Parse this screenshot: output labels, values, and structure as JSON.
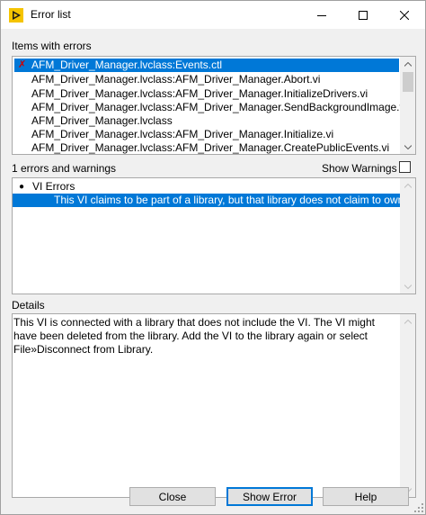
{
  "window": {
    "title": "Error list",
    "colors": {
      "accent": "#0078d7",
      "error": "#d00000",
      "titlebar": "#ffffff",
      "body": "#f0f0f0"
    }
  },
  "items_section": {
    "label": "Items with errors",
    "items": [
      {
        "text": "AFM_Driver_Manager.lvclass:Events.ctl",
        "selected": true,
        "icon": "error-x-icon"
      },
      {
        "text": "AFM_Driver_Manager.lvclass:AFM_Driver_Manager.Abort.vi",
        "selected": false
      },
      {
        "text": "AFM_Driver_Manager.lvclass:AFM_Driver_Manager.InitializeDrivers.vi",
        "selected": false
      },
      {
        "text": "AFM_Driver_Manager.lvclass:AFM_Driver_Manager.SendBackgroundImage.vi",
        "selected": false
      },
      {
        "text": "AFM_Driver_Manager.lvclass",
        "selected": false
      },
      {
        "text": "AFM_Driver_Manager.lvclass:AFM_Driver_Manager.Initialize.vi",
        "selected": false
      },
      {
        "text": "AFM_Driver_Manager.lvclass:AFM_Driver_Manager.CreatePublicEvents.vi",
        "selected": false
      }
    ]
  },
  "errors_section": {
    "count_label": "1 errors and warnings",
    "show_warnings_label": "Show Warnings",
    "show_warnings_checked": false,
    "group_label": "VI Errors",
    "error_message": "This VI claims to be part of a library, but that library does not claim to own th"
  },
  "details_section": {
    "label": "Details",
    "text": "This VI is connected with a library that does not include the VI. The VI might have been deleted from the library. Add the VI to the library again or select File»Disconnect from Library."
  },
  "buttons": {
    "close": "Close",
    "show_error": "Show Error",
    "help": "Help"
  }
}
